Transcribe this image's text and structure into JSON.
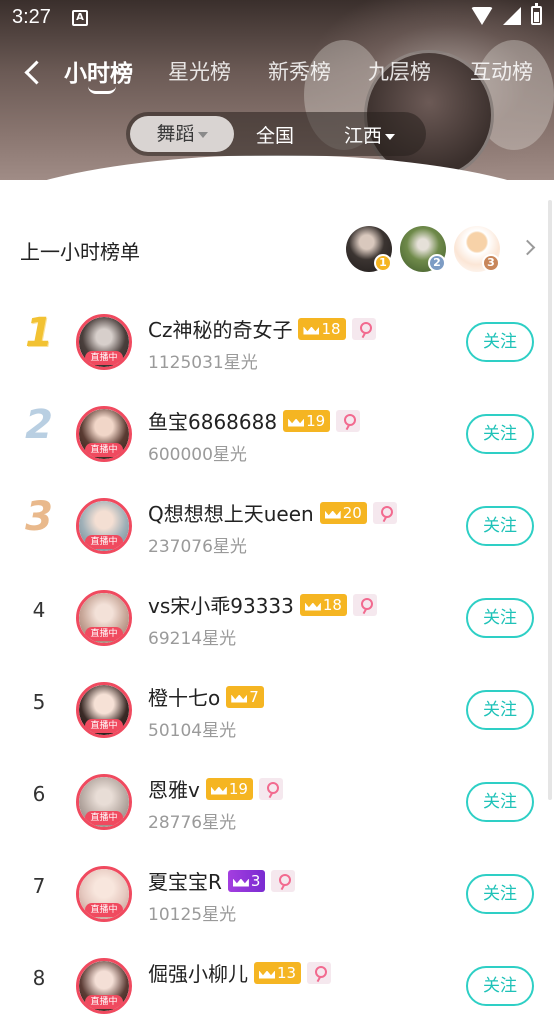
{
  "status_bar": {
    "time": "3:27",
    "indicator_a": "A",
    "icons": [
      "wifi-icon",
      "signal-icon",
      "battery-icon"
    ]
  },
  "nav": {
    "tabs": [
      {
        "label": "小时榜",
        "active": true
      },
      {
        "label": "星光榜",
        "active": false
      },
      {
        "label": "新秀榜",
        "active": false
      },
      {
        "label": "九层榜",
        "active": false
      },
      {
        "label": "互动榜",
        "active": false
      }
    ]
  },
  "region_filter": {
    "items": [
      {
        "label": "舞蹈",
        "active": true,
        "has_caret": true
      },
      {
        "label": "全国",
        "active": false,
        "has_caret": false
      },
      {
        "label": "江西",
        "active": false,
        "has_caret": true
      }
    ]
  },
  "previous_hour": {
    "title": "上一小时榜单",
    "top3": [
      {
        "rank": "1",
        "badge_color": "#f5b522"
      },
      {
        "rank": "2",
        "badge_color": "#7d9cc4"
      },
      {
        "rank": "3",
        "badge_color": "#c8865a"
      }
    ]
  },
  "ranking": [
    {
      "rank": "1",
      "name": "Cz神秘的奇女子",
      "level": "18",
      "level_style": "gold",
      "stars": "1125031星光",
      "live": "直播中",
      "follow": "关注"
    },
    {
      "rank": "2",
      "name": "鱼宝6868688",
      "level": "19",
      "level_style": "gold",
      "stars": "600000星光",
      "live": "直播中",
      "follow": "关注"
    },
    {
      "rank": "3",
      "name": "Q想想想上天ueen",
      "level": "20",
      "level_style": "gold",
      "stars": "237076星光",
      "live": "直播中",
      "follow": "关注"
    },
    {
      "rank": "4",
      "name": "vs宋小乖93333",
      "level": "18",
      "level_style": "gold",
      "stars": "69214星光",
      "live": "直播中",
      "follow": "关注"
    },
    {
      "rank": "5",
      "name": "橙十七o",
      "level": "7",
      "level_style": "gold",
      "stars": "50104星光",
      "live": "直播中",
      "follow": "关注"
    },
    {
      "rank": "6",
      "name": "恩雅v",
      "level": "19",
      "level_style": "gold",
      "stars": "28776星光",
      "live": "直播中",
      "follow": "关注"
    },
    {
      "rank": "7",
      "name": "夏宝宝R",
      "level": "3",
      "level_style": "purple",
      "stars": "10125星光",
      "live": "直播中",
      "follow": "关注"
    },
    {
      "rank": "8",
      "name": "倔强小柳儿",
      "level": "13",
      "level_style": "gold",
      "stars": "",
      "live": "直播中",
      "follow": "关注"
    }
  ],
  "colors": {
    "accent_follow": "#2ecfc5",
    "live_red": "#f04a5f",
    "level_gold": "#f5b522",
    "level_purple": "#8d33d8"
  }
}
